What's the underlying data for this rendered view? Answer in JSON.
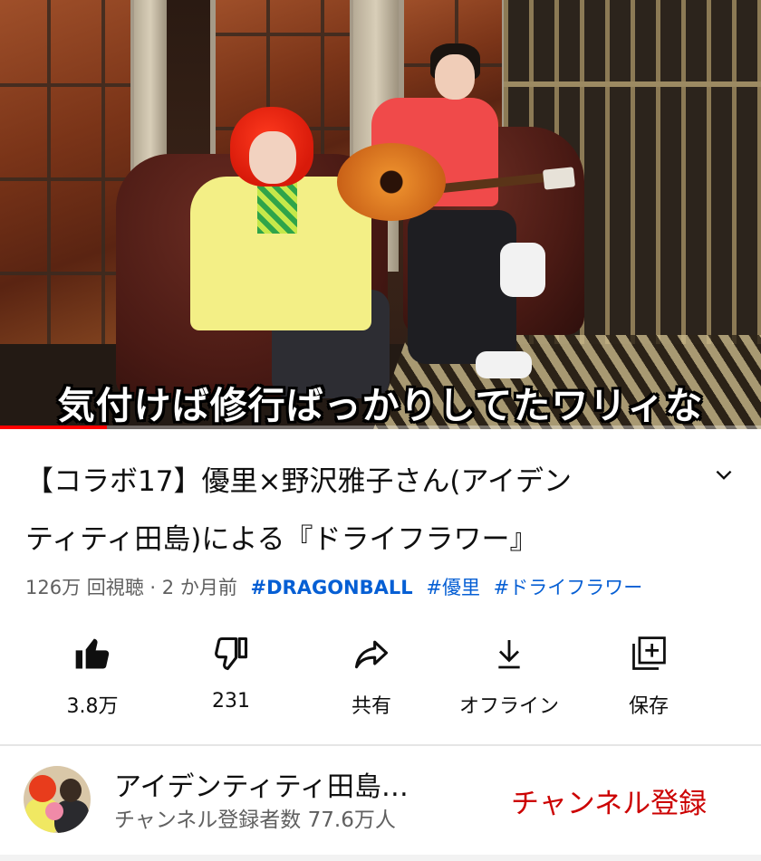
{
  "video": {
    "subtitle": "気付けば修行ばっかりしてたワリィな",
    "progress_percent": 14
  },
  "title": {
    "line1": "【コラボ17】優里×野沢雅子さん(アイデン",
    "line2": "ティティ田島)による『ドライフラワー』"
  },
  "meta": {
    "views_and_time": "126万 回視聴 · 2 か月前",
    "hashtags": [
      "#DRAGONBALL",
      "#優里",
      "#ドライフラワー"
    ]
  },
  "actions": {
    "like": {
      "label": "3.8万",
      "icon": "thumbs-up-filled-icon"
    },
    "dislike": {
      "label": "231",
      "icon": "thumbs-down-icon"
    },
    "share": {
      "label": "共有",
      "icon": "share-arrow-icon"
    },
    "offline": {
      "label": "オフライン",
      "icon": "download-icon"
    },
    "save": {
      "label": "保存",
      "icon": "add-to-playlist-icon"
    }
  },
  "channel": {
    "name": "アイデンティティ田島…",
    "subscribers": "チャンネル登録者数 77.6万人",
    "subscribe_label": "チャンネル登録"
  },
  "colors": {
    "progress": "#ff0000",
    "hashtag": "#065fd4",
    "subscribe": "#cc0000",
    "meta_text": "#606060"
  }
}
